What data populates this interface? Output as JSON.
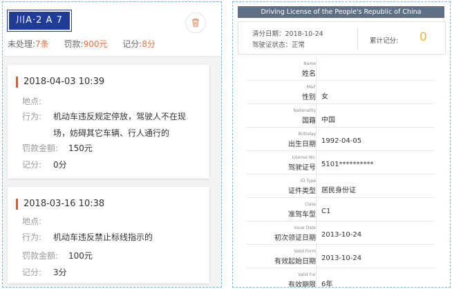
{
  "left": {
    "plate": "川A·2 A 7",
    "summary": {
      "unhandled_label": "未处理:",
      "unhandled_value": "7条",
      "fine_label": "罚款:",
      "fine_value": "900元",
      "points_label": "记分:",
      "points_value": "8分"
    },
    "records": [
      {
        "time": "2018-04-03 10:39",
        "location_label": "地点:",
        "location_value": "",
        "action_label": "行为:",
        "action_value": "机动车违反规定停放，驾驶人不在现场，妨碍其它车辆、行人通行的",
        "fine_label": "罚款金额:",
        "fine_value": "150元",
        "points_label": "记分:",
        "points_value": "0分"
      },
      {
        "time": "2018-03-16 10:38",
        "location_label": "地点:",
        "location_value": "",
        "action_label": "行为:",
        "action_value": "机动车违反禁止标线指示的",
        "fine_label": "罚款金额:",
        "fine_value": "100元",
        "points_label": "记分:",
        "points_value": "3分"
      }
    ]
  },
  "right": {
    "title": "Driving License of the People's Republic of China",
    "clear_date": "清分日期：2018-10-24",
    "license_status": "驾驶证状态：正常",
    "accum_points_label": "累计记分:",
    "accum_points_value": "0",
    "fields": [
      {
        "en": "Name",
        "zh": "姓名",
        "value": ""
      },
      {
        "en": "M&F",
        "zh": "性别",
        "value": "女"
      },
      {
        "en": "Nationality",
        "zh": "国籍",
        "value": "中国"
      },
      {
        "en": "Birthday",
        "zh": "出生日期",
        "value": "1992-04-05"
      },
      {
        "en": "License No.",
        "zh": "驾驶证号",
        "value": "5101**********"
      },
      {
        "en": "ID Type",
        "zh": "证件类型",
        "value": "居民身份证"
      },
      {
        "en": "Class",
        "zh": "准驾车型",
        "value": "C1"
      },
      {
        "en": "Issue Date",
        "zh": "初次领证日期",
        "value": "2013-10-24"
      },
      {
        "en": "Valid Form",
        "zh": "有效起始日期",
        "value": "2013-10-24"
      },
      {
        "en": "Valid For",
        "zh": "有效期限",
        "value": "6年"
      }
    ]
  },
  "colors": {
    "plate_blue": "#1f3c96",
    "accent_orange": "#e8703b",
    "record_marker_red": "#e8503b",
    "title_bar": "#5f6f84",
    "points_yellow": "#f2b230"
  },
  "icons": {
    "delete": "trash-icon"
  }
}
